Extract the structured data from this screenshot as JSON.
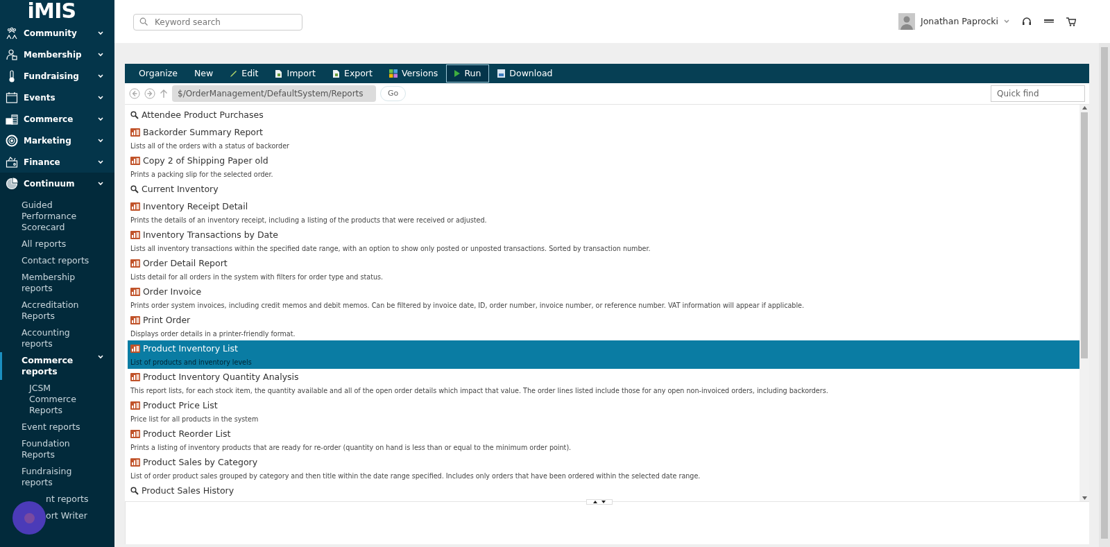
{
  "logo": "iMIS",
  "nav": [
    {
      "label": "Community",
      "kind": "people",
      "expanded": false
    },
    {
      "label": "Membership",
      "kind": "member",
      "expanded": false
    },
    {
      "label": "Fundraising",
      "kind": "thermo",
      "expanded": false
    },
    {
      "label": "Events",
      "kind": "calendar",
      "expanded": false
    },
    {
      "label": "Commerce",
      "kind": "shop",
      "expanded": false
    },
    {
      "label": "Marketing",
      "kind": "target",
      "expanded": false
    },
    {
      "label": "Finance",
      "kind": "wallet",
      "expanded": false
    },
    {
      "label": "Continuum",
      "kind": "pie",
      "expanded": true,
      "children": [
        {
          "label": "Guided Performance Scorecard",
          "selected": false
        },
        {
          "label": "All reports",
          "selected": false
        },
        {
          "label": "Contact reports",
          "selected": false
        },
        {
          "label": "Membership reports",
          "selected": false
        },
        {
          "label": "Accreditation Reports",
          "selected": false
        },
        {
          "label": "Accounting reports",
          "selected": false
        },
        {
          "label": "Commerce reports",
          "selected": true,
          "children": [
            {
              "label": "JCSM Commerce Reports",
              "selected": false
            }
          ]
        },
        {
          "label": "Event reports",
          "selected": false
        },
        {
          "label": "Foundation Reports",
          "selected": false
        },
        {
          "label": "Fundraising reports",
          "selected": false
        },
        {
          "label": "nt reports",
          "selected": false,
          "kind": "covered"
        },
        {
          "label": "ort Writer",
          "selected": false,
          "kind": "covered"
        }
      ]
    }
  ],
  "search": {
    "placeholder": "Keyword search"
  },
  "user": {
    "name": "Jonathan Paprocki"
  },
  "toolbar": [
    {
      "label": "Organize",
      "kind": "plain",
      "selected": false
    },
    {
      "label": "New",
      "kind": "plain",
      "selected": false
    },
    {
      "label": "Edit",
      "kind": "pencil",
      "selected": false
    },
    {
      "label": "Import",
      "kind": "doc",
      "selected": false
    },
    {
      "label": "Export",
      "kind": "doc",
      "selected": false
    },
    {
      "label": "Versions",
      "kind": "grid",
      "selected": false
    },
    {
      "label": "Run",
      "kind": "play",
      "selected": true
    },
    {
      "label": "Download",
      "kind": "save",
      "selected": false
    }
  ],
  "path": {
    "value": "$/OrderManagement/DefaultSystem/Reports",
    "go": "Go"
  },
  "quick_find": {
    "placeholder": "Quick find"
  },
  "items": [
    {
      "kind": "query",
      "title": "Attendee Product Purchases",
      "selected": false
    },
    {
      "kind": "report",
      "title": "Backorder Summary Report",
      "description": "Lists all of the orders with a status of backorder",
      "selected": false
    },
    {
      "kind": "report",
      "title": "Copy 2 of Shipping Paper old",
      "description": "Prints a packing slip for the selected order.",
      "selected": false
    },
    {
      "kind": "query",
      "title": "Current Inventory",
      "selected": false
    },
    {
      "kind": "report",
      "title": "Inventory Receipt Detail",
      "description": "Prints the details of an inventory receipt, including a listing of the products that were received or adjusted.",
      "selected": false
    },
    {
      "kind": "report",
      "title": "Inventory Transactions by Date",
      "description": "Lists all inventory transactions within the specified date range, with an option to show only posted or unposted transactions. Sorted by transaction number.",
      "selected": false
    },
    {
      "kind": "report",
      "title": "Order Detail Report",
      "description": "Lists detail for all orders in the system with filters for order type and status.",
      "selected": false
    },
    {
      "kind": "report",
      "title": "Order Invoice",
      "description": "Prints order system invoices, including credit memos and debit memos. Can be filtered by invoice date, ID, order number, invoice number, or reference number. VAT information will appear if applicable.",
      "selected": false
    },
    {
      "kind": "report",
      "title": "Print Order",
      "description": "Displays order details in a printer-friendly format.",
      "selected": false
    },
    {
      "kind": "report",
      "title": "Product Inventory List",
      "description": "List of products and inventory levels",
      "selected": true
    },
    {
      "kind": "report",
      "title": "Product Inventory Quantity Analysis",
      "description": "This report lists, for each stock item, the quantity available and all of the open order details which impact that value. The order lines listed include those for any open non-invoiced orders, including backorders.",
      "selected": false
    },
    {
      "kind": "report",
      "title": "Product Price List",
      "description": "Price list for all products in the system",
      "selected": false
    },
    {
      "kind": "report",
      "title": "Product Reorder List",
      "description": "Prints a listing of inventory products that are ready for re-order (quantity on hand is less than or equal to the minimum order point).",
      "selected": false
    },
    {
      "kind": "report",
      "title": "Product Sales by Category",
      "description": "List of order product sales grouped by category and then title within the date range specified. Includes only orders that have been ordered within the selected date range.",
      "selected": false
    },
    {
      "kind": "query",
      "title": "Product Sales History",
      "selected": false
    }
  ]
}
